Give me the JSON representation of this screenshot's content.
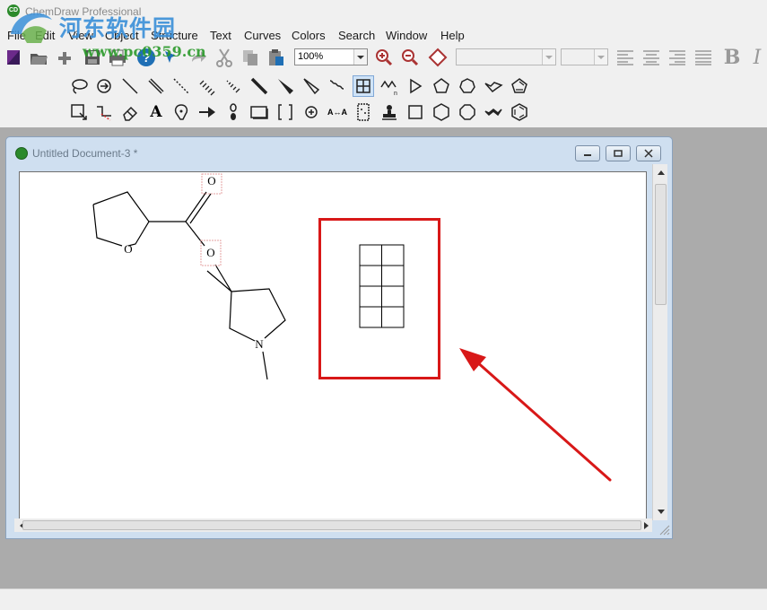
{
  "app": {
    "title": "ChemDraw Professional",
    "icon": "chemdraw-app-icon"
  },
  "watermark": {
    "site_name": "河东软件园",
    "url": "www.pc0359.cn"
  },
  "menubar": {
    "items": [
      {
        "label": "File"
      },
      {
        "label": "Edit"
      },
      {
        "label": "View"
      },
      {
        "label": "Object"
      },
      {
        "label": "Structure"
      },
      {
        "label": "Text"
      },
      {
        "label": "Curves"
      },
      {
        "label": "Colors"
      },
      {
        "label": "Search"
      },
      {
        "label": "Window"
      },
      {
        "label": "Help"
      }
    ]
  },
  "toolbar_main": {
    "buttons": [
      {
        "name": "new-document",
        "icon": "new-document-icon"
      },
      {
        "name": "open",
        "icon": "open-folder-icon"
      },
      {
        "name": "templates",
        "icon": "templates-icon"
      },
      {
        "name": "save",
        "icon": "save-icon"
      },
      {
        "name": "print",
        "icon": "print-icon"
      },
      {
        "name": "help",
        "icon": "help-icon"
      },
      {
        "name": "undo",
        "icon": "undo-icon"
      },
      {
        "name": "redo",
        "icon": "redo-icon"
      },
      {
        "name": "cut",
        "icon": "cut-icon"
      },
      {
        "name": "copy",
        "icon": "copy-icon"
      },
      {
        "name": "paste",
        "icon": "paste-icon"
      }
    ],
    "zoom_value": "100%",
    "zoom_in_icon": "zoom-in-icon",
    "zoom_out_icon": "zoom-out-icon",
    "fit_icon": "fit-to-window-icon",
    "font_select_value": "",
    "font_size_value": "",
    "align": [
      "align-left-icon",
      "align-center-icon",
      "align-right-icon",
      "justify-icon"
    ],
    "bold_label": "B",
    "italic_label": "I"
  },
  "toolbar_tools_row1": [
    {
      "name": "lasso",
      "icon": "lasso-icon"
    },
    {
      "name": "structure-perspective",
      "icon": "rotate-3d-icon"
    },
    {
      "name": "solid-bond",
      "icon": "solid-bond-icon"
    },
    {
      "name": "double-bond",
      "icon": "double-bond-icon"
    },
    {
      "name": "dashed-bond",
      "icon": "dashed-bond-icon"
    },
    {
      "name": "hashed-bond",
      "icon": "hashed-bond-icon"
    },
    {
      "name": "hashed-wedge",
      "icon": "hashed-wedge-icon"
    },
    {
      "name": "bold-bond",
      "icon": "bold-bond-icon"
    },
    {
      "name": "wedge-bond",
      "icon": "wedge-bond-icon"
    },
    {
      "name": "hollow-wedge",
      "icon": "hollow-wedge-icon"
    },
    {
      "name": "wavy-bond",
      "icon": "wavy-bond-icon"
    },
    {
      "name": "table",
      "icon": "table-icon",
      "pressed": true
    },
    {
      "name": "chain",
      "icon": "chain-icon"
    },
    {
      "name": "cyclopropane",
      "icon": "triangle-ring-icon"
    },
    {
      "name": "cyclopentane",
      "icon": "pentagon-ring-icon"
    },
    {
      "name": "cycloheptane",
      "icon": "heptagon-ring-icon"
    },
    {
      "name": "cyclohexane-chair",
      "icon": "chair-ring-icon"
    },
    {
      "name": "cyclopentadiene",
      "icon": "cyclopentadiene-icon"
    }
  ],
  "toolbar_tools_row2": [
    {
      "name": "marquee",
      "icon": "marquee-select-icon"
    },
    {
      "name": "eraser-bond",
      "icon": "bond-eraser-icon"
    },
    {
      "name": "eraser",
      "icon": "eraser-icon"
    },
    {
      "name": "text",
      "icon": "text-tool-icon",
      "label": "A"
    },
    {
      "name": "pen",
      "icon": "pen-icon"
    },
    {
      "name": "arrow",
      "icon": "arrow-tool-icon"
    },
    {
      "name": "orbital",
      "icon": "orbital-icon"
    },
    {
      "name": "drawing-elements",
      "icon": "rectangle-tool-icon"
    },
    {
      "name": "brackets",
      "icon": "brackets-icon"
    },
    {
      "name": "chemical-symbols",
      "icon": "charge-symbol-icon"
    },
    {
      "name": "query",
      "icon": "query-icon",
      "label": "A↔A"
    },
    {
      "name": "tlc-plate",
      "icon": "tlc-plate-icon"
    },
    {
      "name": "templates-stamp",
      "icon": "stamp-icon"
    },
    {
      "name": "cyclobutane",
      "icon": "square-ring-icon"
    },
    {
      "name": "cyclohexane",
      "icon": "hexagon-ring-icon"
    },
    {
      "name": "cyclooctane",
      "icon": "octagon-ring-icon"
    },
    {
      "name": "cyclohexane-boat",
      "icon": "boat-ring-icon"
    },
    {
      "name": "benzene",
      "icon": "benzene-icon"
    }
  ],
  "document": {
    "title": "Untitled Document-3 *",
    "controls": [
      "minimize-icon",
      "restore-icon",
      "close-icon"
    ],
    "atoms": [
      {
        "label": "O",
        "role": "carbonyl-oxygen"
      },
      {
        "label": "O",
        "role": "ester-oxygen"
      },
      {
        "label": "O",
        "role": "ring-oxygen"
      },
      {
        "label": "N",
        "role": "ring-nitrogen"
      }
    ],
    "table_object": {
      "rows": 4,
      "cols": 2
    }
  },
  "annotation": {
    "color": "#d81818",
    "highlight": "table-object",
    "arrow": "pointing-to-table"
  }
}
